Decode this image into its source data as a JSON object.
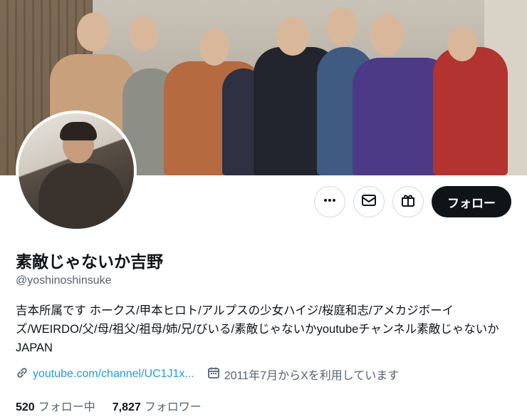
{
  "profile": {
    "display_name": "素敵じゃないか吉野",
    "handle": "@yoshinoshinsuke",
    "bio": "吉本所属です ホークス/甲本ヒロト/アルプスの少女ハイジ/桜庭和志/アメカジボーイズ/WEIRDO/父/母/祖父/祖母/姉/兄/びいる/素敵じゃないかyoutubeチャンネル素敵じゃないかJAPAN",
    "website": "youtube.com/channel/UC1J1x...",
    "joined": "2011年7月からXを利用しています"
  },
  "actions": {
    "more_icon": "ellipsis-icon",
    "message_icon": "envelope-icon",
    "subscribe_icon": "gift-icon",
    "follow_label": "フォロー"
  },
  "stats": {
    "following_count": "520",
    "following_label": "フォロー中",
    "followers_count": "7,827",
    "followers_label": "フォロワー"
  },
  "colors": {
    "accent": "#1d9bf0",
    "text": "#0f1419",
    "muted": "#536471"
  }
}
